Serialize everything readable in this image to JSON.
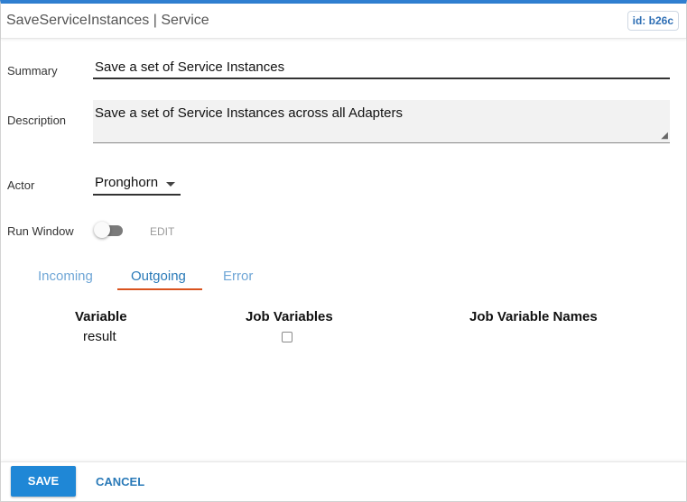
{
  "header": {
    "title": "SaveServiceInstances | Service",
    "id_badge": "id: b26c"
  },
  "form": {
    "summary_label": "Summary",
    "summary_value": "Save a set of Service Instances",
    "description_label": "Description",
    "description_value": "Save a set of Service Instances across all Adapters",
    "actor_label": "Actor",
    "actor_value": "Pronghorn",
    "run_window_label": "Run Window",
    "run_window_enabled": false,
    "edit_label": "EDIT"
  },
  "tabs": [
    {
      "label": "Incoming",
      "active": false
    },
    {
      "label": "Outgoing",
      "active": true
    },
    {
      "label": "Error",
      "active": false
    }
  ],
  "table": {
    "columns": [
      "Variable",
      "Job Variables",
      "Job Variable Names"
    ],
    "rows": [
      {
        "variable": "result",
        "job_variable_checked": false,
        "job_variable_name": ""
      }
    ]
  },
  "footer": {
    "save_label": "SAVE",
    "cancel_label": "CANCEL"
  },
  "colors": {
    "accent": "#1f87d6",
    "tab_active_underline": "#d9531e"
  }
}
